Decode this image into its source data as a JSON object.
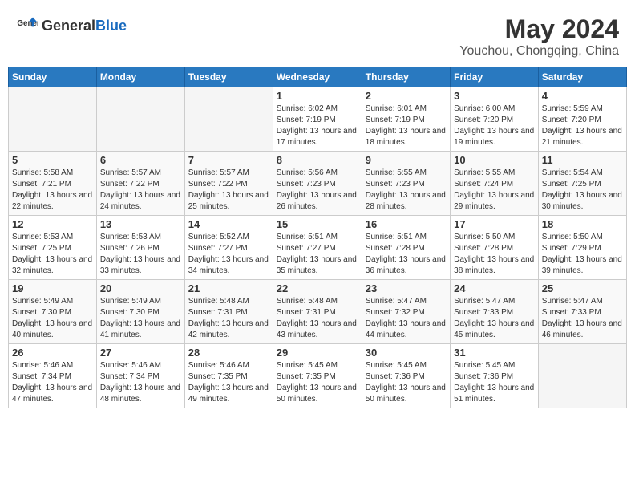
{
  "header": {
    "logo": {
      "general": "General",
      "blue": "Blue"
    },
    "title": "May 2024",
    "location": "Youchou, Chongqing, China"
  },
  "weekdays": [
    "Sunday",
    "Monday",
    "Tuesday",
    "Wednesday",
    "Thursday",
    "Friday",
    "Saturday"
  ],
  "weeks": [
    [
      {
        "day": "",
        "sunrise": "",
        "sunset": "",
        "daylight": ""
      },
      {
        "day": "",
        "sunrise": "",
        "sunset": "",
        "daylight": ""
      },
      {
        "day": "",
        "sunrise": "",
        "sunset": "",
        "daylight": ""
      },
      {
        "day": "1",
        "sunrise": "Sunrise: 6:02 AM",
        "sunset": "Sunset: 7:19 PM",
        "daylight": "Daylight: 13 hours and 17 minutes."
      },
      {
        "day": "2",
        "sunrise": "Sunrise: 6:01 AM",
        "sunset": "Sunset: 7:19 PM",
        "daylight": "Daylight: 13 hours and 18 minutes."
      },
      {
        "day": "3",
        "sunrise": "Sunrise: 6:00 AM",
        "sunset": "Sunset: 7:20 PM",
        "daylight": "Daylight: 13 hours and 19 minutes."
      },
      {
        "day": "4",
        "sunrise": "Sunrise: 5:59 AM",
        "sunset": "Sunset: 7:20 PM",
        "daylight": "Daylight: 13 hours and 21 minutes."
      }
    ],
    [
      {
        "day": "5",
        "sunrise": "Sunrise: 5:58 AM",
        "sunset": "Sunset: 7:21 PM",
        "daylight": "Daylight: 13 hours and 22 minutes."
      },
      {
        "day": "6",
        "sunrise": "Sunrise: 5:57 AM",
        "sunset": "Sunset: 7:22 PM",
        "daylight": "Daylight: 13 hours and 24 minutes."
      },
      {
        "day": "7",
        "sunrise": "Sunrise: 5:57 AM",
        "sunset": "Sunset: 7:22 PM",
        "daylight": "Daylight: 13 hours and 25 minutes."
      },
      {
        "day": "8",
        "sunrise": "Sunrise: 5:56 AM",
        "sunset": "Sunset: 7:23 PM",
        "daylight": "Daylight: 13 hours and 26 minutes."
      },
      {
        "day": "9",
        "sunrise": "Sunrise: 5:55 AM",
        "sunset": "Sunset: 7:23 PM",
        "daylight": "Daylight: 13 hours and 28 minutes."
      },
      {
        "day": "10",
        "sunrise": "Sunrise: 5:55 AM",
        "sunset": "Sunset: 7:24 PM",
        "daylight": "Daylight: 13 hours and 29 minutes."
      },
      {
        "day": "11",
        "sunrise": "Sunrise: 5:54 AM",
        "sunset": "Sunset: 7:25 PM",
        "daylight": "Daylight: 13 hours and 30 minutes."
      }
    ],
    [
      {
        "day": "12",
        "sunrise": "Sunrise: 5:53 AM",
        "sunset": "Sunset: 7:25 PM",
        "daylight": "Daylight: 13 hours and 32 minutes."
      },
      {
        "day": "13",
        "sunrise": "Sunrise: 5:53 AM",
        "sunset": "Sunset: 7:26 PM",
        "daylight": "Daylight: 13 hours and 33 minutes."
      },
      {
        "day": "14",
        "sunrise": "Sunrise: 5:52 AM",
        "sunset": "Sunset: 7:27 PM",
        "daylight": "Daylight: 13 hours and 34 minutes."
      },
      {
        "day": "15",
        "sunrise": "Sunrise: 5:51 AM",
        "sunset": "Sunset: 7:27 PM",
        "daylight": "Daylight: 13 hours and 35 minutes."
      },
      {
        "day": "16",
        "sunrise": "Sunrise: 5:51 AM",
        "sunset": "Sunset: 7:28 PM",
        "daylight": "Daylight: 13 hours and 36 minutes."
      },
      {
        "day": "17",
        "sunrise": "Sunrise: 5:50 AM",
        "sunset": "Sunset: 7:28 PM",
        "daylight": "Daylight: 13 hours and 38 minutes."
      },
      {
        "day": "18",
        "sunrise": "Sunrise: 5:50 AM",
        "sunset": "Sunset: 7:29 PM",
        "daylight": "Daylight: 13 hours and 39 minutes."
      }
    ],
    [
      {
        "day": "19",
        "sunrise": "Sunrise: 5:49 AM",
        "sunset": "Sunset: 7:30 PM",
        "daylight": "Daylight: 13 hours and 40 minutes."
      },
      {
        "day": "20",
        "sunrise": "Sunrise: 5:49 AM",
        "sunset": "Sunset: 7:30 PM",
        "daylight": "Daylight: 13 hours and 41 minutes."
      },
      {
        "day": "21",
        "sunrise": "Sunrise: 5:48 AM",
        "sunset": "Sunset: 7:31 PM",
        "daylight": "Daylight: 13 hours and 42 minutes."
      },
      {
        "day": "22",
        "sunrise": "Sunrise: 5:48 AM",
        "sunset": "Sunset: 7:31 PM",
        "daylight": "Daylight: 13 hours and 43 minutes."
      },
      {
        "day": "23",
        "sunrise": "Sunrise: 5:47 AM",
        "sunset": "Sunset: 7:32 PM",
        "daylight": "Daylight: 13 hours and 44 minutes."
      },
      {
        "day": "24",
        "sunrise": "Sunrise: 5:47 AM",
        "sunset": "Sunset: 7:33 PM",
        "daylight": "Daylight: 13 hours and 45 minutes."
      },
      {
        "day": "25",
        "sunrise": "Sunrise: 5:47 AM",
        "sunset": "Sunset: 7:33 PM",
        "daylight": "Daylight: 13 hours and 46 minutes."
      }
    ],
    [
      {
        "day": "26",
        "sunrise": "Sunrise: 5:46 AM",
        "sunset": "Sunset: 7:34 PM",
        "daylight": "Daylight: 13 hours and 47 minutes."
      },
      {
        "day": "27",
        "sunrise": "Sunrise: 5:46 AM",
        "sunset": "Sunset: 7:34 PM",
        "daylight": "Daylight: 13 hours and 48 minutes."
      },
      {
        "day": "28",
        "sunrise": "Sunrise: 5:46 AM",
        "sunset": "Sunset: 7:35 PM",
        "daylight": "Daylight: 13 hours and 49 minutes."
      },
      {
        "day": "29",
        "sunrise": "Sunrise: 5:45 AM",
        "sunset": "Sunset: 7:35 PM",
        "daylight": "Daylight: 13 hours and 50 minutes."
      },
      {
        "day": "30",
        "sunrise": "Sunrise: 5:45 AM",
        "sunset": "Sunset: 7:36 PM",
        "daylight": "Daylight: 13 hours and 50 minutes."
      },
      {
        "day": "31",
        "sunrise": "Sunrise: 5:45 AM",
        "sunset": "Sunset: 7:36 PM",
        "daylight": "Daylight: 13 hours and 51 minutes."
      },
      {
        "day": "",
        "sunrise": "",
        "sunset": "",
        "daylight": ""
      }
    ]
  ]
}
